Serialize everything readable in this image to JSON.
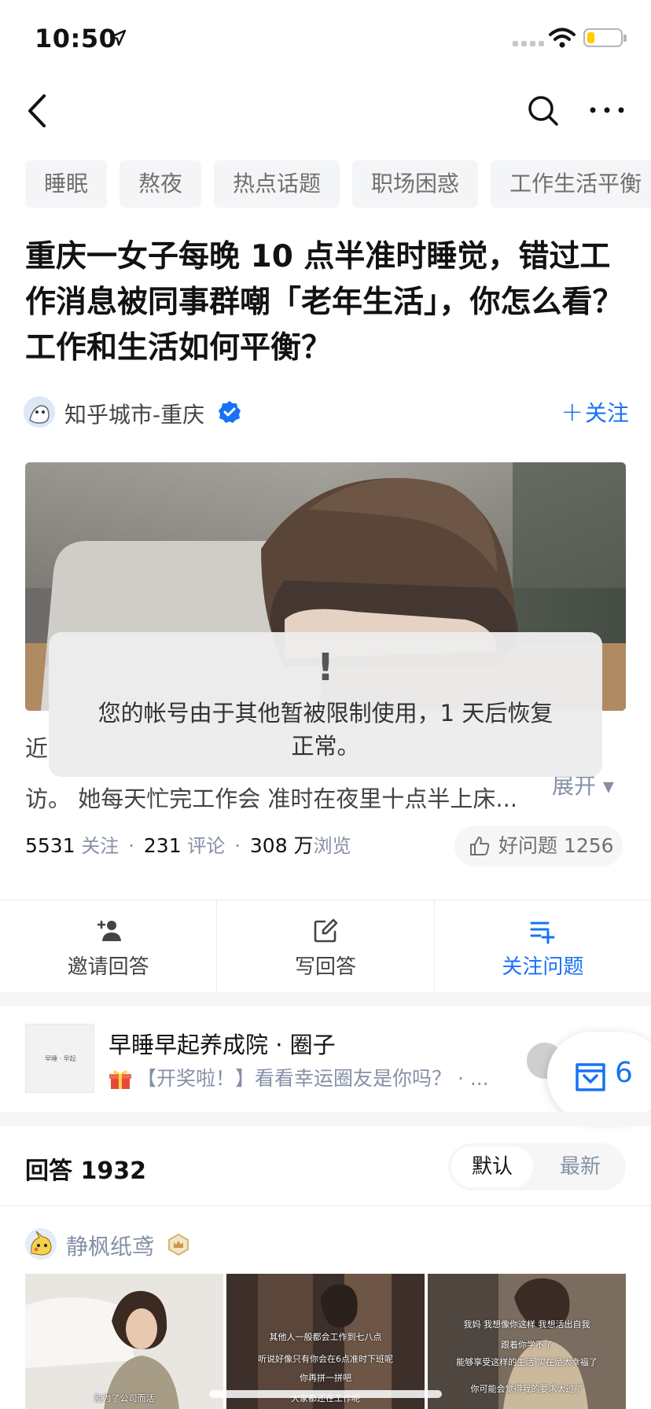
{
  "status_bar": {
    "time": "10:50"
  },
  "tags": [
    "睡眠",
    "熬夜",
    "热点话题",
    "职场困惑",
    "工作生活平衡"
  ],
  "question": {
    "title": "重庆一女子每晚 10 点半准时睡觉，错过工作消息被同事群嘲「老年生活」，你怎么看？工作和生活如何平衡？",
    "author": "知乎城市-重庆",
    "follow_label": "关注",
    "follow_plus": "+",
    "desc_line1": "近",
    "desc_line2": "访。 她每天忙完工作会 准时在夜里十点半上床...",
    "expand_label": "展开 ▾"
  },
  "toast": {
    "icon": "!",
    "message": "您的帐号由于其他暂被限制使用，1 天后恢复正常。"
  },
  "stats": {
    "follows_count": "5531",
    "follows_label": "关注",
    "comments_count": "231",
    "comments_label": "评论",
    "views_count": "308 万",
    "views_label": "浏览",
    "good_question_label": "好问题 1256"
  },
  "actions": [
    {
      "label": "邀请回答",
      "icon": "invite-icon"
    },
    {
      "label": "写回答",
      "icon": "edit-icon"
    },
    {
      "label": "关注问题",
      "icon": "follow-list-icon"
    }
  ],
  "circle": {
    "title": "早睡早起养成院 · 圈子",
    "subtitle": "【开奖啦！】看看幸运圈友是你吗？ · ...",
    "thumb_text": "早睡 · 早起",
    "float_count": "6"
  },
  "answers": {
    "title": "回答 1932",
    "sort_default": "默认",
    "sort_latest": "最新"
  },
  "first_answer": {
    "author": "静枫纸鸢",
    "images": [
      {
        "caption": "别为了公司而活"
      },
      {
        "caption_top": "其他人一般都会工作到七八点",
        "caption_mid": "听说好像只有你会在6点准时下班呢",
        "caption_mid2": "你再拼一拼吧",
        "caption": "大家都还在工作呢"
      },
      {
        "caption_top": "我妈 我想像你这样 我想活出自我",
        "caption_mid": "跟着你学不了",
        "caption_mid2": "能够享受这样的生活 实在是太幸福了",
        "caption": "你可能会觉得我的要求太过了"
      }
    ]
  },
  "colors": {
    "accent": "#1772f6",
    "text": "#121212",
    "muted": "#8590a6"
  }
}
